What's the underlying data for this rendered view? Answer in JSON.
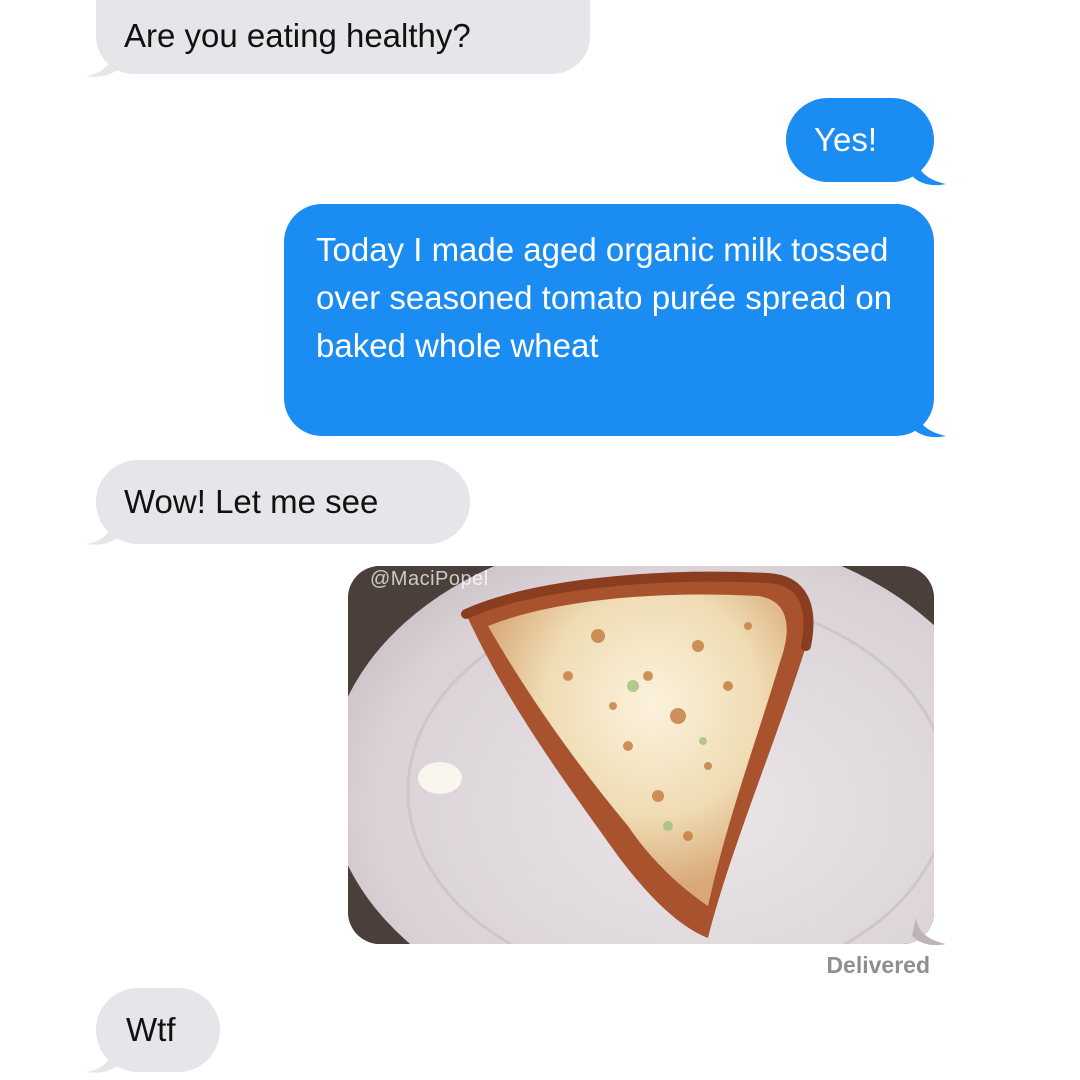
{
  "conversation": {
    "messages": [
      {
        "from": "them",
        "text": "Are you eating healthy?"
      },
      {
        "from": "me",
        "text": "Yes!"
      },
      {
        "from": "me",
        "text": "Today I made aged organic milk tossed over seasoned tomato purée spread on baked whole wheat"
      },
      {
        "from": "them",
        "text": "Wow! Let me see"
      },
      {
        "from": "me",
        "type": "image",
        "image_description": "pizza-slice-on-plate",
        "watermark": "@MaciPopel"
      },
      {
        "from": "them",
        "text": "Wtf"
      }
    ],
    "delivery_status": "Delivered"
  },
  "colors": {
    "received_bubble": "#e5e5ea",
    "sent_bubble": "#1a8cf2",
    "background": "#ffffff",
    "status_text": "#8e8e93"
  }
}
